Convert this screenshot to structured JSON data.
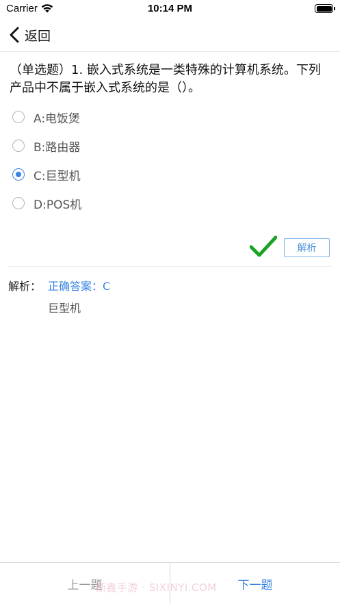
{
  "status_bar": {
    "carrier": "Carrier",
    "time": "10:14 PM",
    "wifi_icon": "wifi-icon",
    "battery_icon": "battery-icon"
  },
  "nav": {
    "back_icon": "chevron-left-icon",
    "back_label": "返回"
  },
  "question": {
    "text": "（单选题）1. 嵌入式系统是一类特殊的计算机系统。下列产品中不属于嵌入式系统的是（）。",
    "options": [
      {
        "label": "A:电饭煲",
        "selected": false
      },
      {
        "label": "B:路由器",
        "selected": false
      },
      {
        "label": "C:巨型机",
        "selected": true
      },
      {
        "label": "D:POS机",
        "selected": false
      }
    ]
  },
  "result": {
    "icon": "checkmark-icon",
    "correct": true,
    "color": "#1aa323"
  },
  "analysis_button_label": "解析",
  "analysis": {
    "label": "解析：",
    "answer": "正确答案：C",
    "explanation": "巨型机"
  },
  "bottom": {
    "prev_label": "上一题",
    "next_label": "下一题"
  },
  "watermark": "斯鑫手游 · SIXINYI.COM",
  "colors": {
    "accent": "#3a84e6",
    "correct_green": "#1aa323",
    "disabled_gray": "#9a9a9a"
  }
}
